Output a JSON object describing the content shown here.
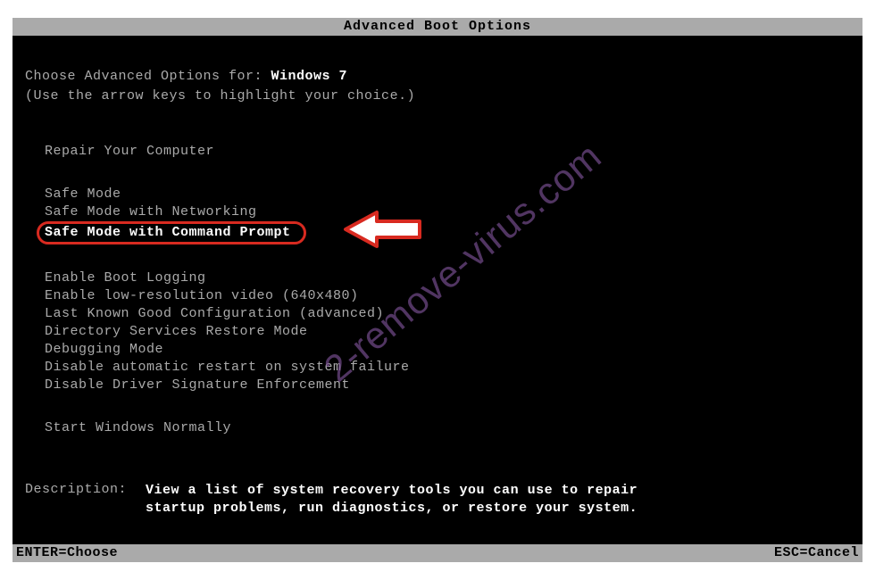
{
  "title": "Advanced Boot Options",
  "prompt": {
    "line1_prefix": "Choose Advanced Options for: ",
    "os": "Windows 7",
    "line2": "(Use the arrow keys to highlight your choice.)"
  },
  "menu": {
    "repair": "Repair Your Computer",
    "safe_mode": "Safe Mode",
    "safe_mode_net": "Safe Mode with Networking",
    "safe_mode_cmd": "Safe Mode with Command Prompt",
    "boot_logging": "Enable Boot Logging",
    "low_res": "Enable low-resolution video (640x480)",
    "last_known": "Last Known Good Configuration (advanced)",
    "ds_restore": "Directory Services Restore Mode",
    "debugging": "Debugging Mode",
    "no_auto_restart": "Disable automatic restart on system failure",
    "no_driver_sig": "Disable Driver Signature Enforcement",
    "start_normal": "Start Windows Normally"
  },
  "description": {
    "label": "Description:",
    "text": "View a list of system recovery tools you can use to repair startup problems, run diagnostics, or restore your system."
  },
  "footer": {
    "enter": "ENTER=Choose",
    "esc": "ESC=Cancel"
  },
  "watermark": "2-remove-virus.com"
}
